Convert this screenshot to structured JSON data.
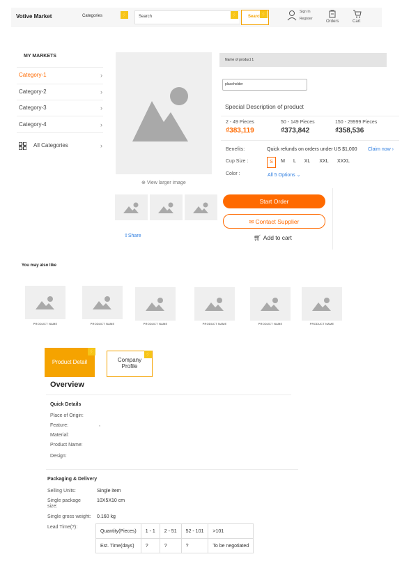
{
  "header": {
    "logo": "Votive Market",
    "categories_label": "Categories",
    "search_placeholder": "Search",
    "search_button": "Search",
    "signin_line1": "Sign In",
    "signin_line2": "Register",
    "orders_label": "Orders",
    "cart_label": "Cart"
  },
  "sidebar": {
    "title": "MY MARKETS",
    "items": [
      {
        "label": "Category-1"
      },
      {
        "label": "Category-2"
      },
      {
        "label": "Category-3"
      },
      {
        "label": "Category-4"
      }
    ],
    "all_categories": "All Categories"
  },
  "product": {
    "view_larger": "View larger image",
    "share": "Share",
    "name_bar": "Name of product 1",
    "input_value": "placeholder",
    "description": "Special Description of product",
    "tiers": [
      {
        "range": "2 - 49 Pieces",
        "price": "₫383,119"
      },
      {
        "range": "50 - 149 Pieces",
        "price": "₫373,842"
      },
      {
        "range": "150 - 29999 Pieces",
        "price": "₫358,536"
      }
    ],
    "benefits_label": "Benefits:",
    "benefits_text": "Quick refunds on orders under US $1,000",
    "claim_now": "Claim now",
    "cup_size_label": "Cup Size :",
    "sizes": [
      "S",
      "M",
      "L",
      "XL",
      "XXL",
      "XXXL"
    ],
    "color_label": "Color :",
    "color_options": "All 5 Options",
    "start_order": "Start Order",
    "contact_supplier": "Contact Supplier",
    "add_to_cart": "Add to cart"
  },
  "also_like": {
    "title": "You may also like",
    "items": [
      "PRODUCT NAME",
      "PRODUCT NAME",
      "PRODUCT NAME",
      "PRODUCT NAME",
      "PRODUCT NAME",
      "PRODUCT NAME"
    ]
  },
  "tabs": {
    "product_detail": "Product Detail",
    "company_line1": "Company",
    "company_line2": "Profile"
  },
  "overview": {
    "title": "Overview",
    "quick_details_title": "Quick Details",
    "quick_details": [
      {
        "label": "Place of Origin:",
        "value": ""
      },
      {
        "label": "Feature:",
        "value": ","
      },
      {
        "label": "Material:",
        "value": ""
      },
      {
        "label": "Product Name:",
        "value": ""
      },
      {
        "label": "Design:",
        "value": ""
      }
    ],
    "packaging_title": "Packaging & Delivery",
    "selling_units_label": "Selling Units:",
    "selling_units_value": "Single item",
    "package_size_label_1": "Single package",
    "package_size_label_2": "size:",
    "package_size_value": "10X5X10 cm",
    "gross_weight_label": "Single gross weight:",
    "gross_weight_value": "0.160 kg",
    "lead_time_label": "Lead Time",
    "lead_table": {
      "row1": [
        "Quantity(Pieces)",
        "1 - 1",
        "2 - 51",
        "52 - 101",
        ">101"
      ],
      "row2": [
        "Est. Time(days)",
        "?",
        "?",
        "?",
        "To be negotiated"
      ]
    }
  },
  "colors": {
    "accent": "#ff6a00",
    "tab_active": "#f5a300",
    "bolt": "#f5c518",
    "link": "#2d7de0"
  }
}
